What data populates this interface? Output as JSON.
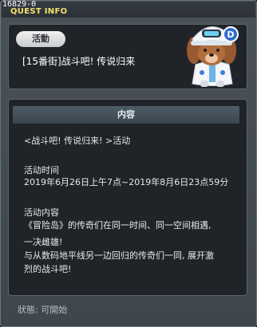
{
  "window": {
    "quest_id": "16829-0",
    "title": "QUEST INFO"
  },
  "header": {
    "category_tag": "活動",
    "quest_name": "[15番街]战斗吧! 传说归来"
  },
  "content": {
    "section_title": "内容",
    "lines": [
      "<战斗吧! 传说归来! >活动",
      "活动时间",
      "2019年6月26日上午7点~2019年8月6日23点59分",
      "活动内容",
      "《冒险岛》的传奇们在同一时间、同一空间相遇,",
      "一决雌雄!",
      "与从数码地平线另一边回归的传奇们一同, 展开激",
      "烈的战斗吧!"
    ]
  },
  "footer": {
    "status": "狀態: 可開始"
  },
  "npc": {
    "icon": "npc-character-icon",
    "badge_letter": "D",
    "colors": {
      "fur": "#b06e3f",
      "helmet": "#f4f6fa",
      "accent": "#3b7fd6",
      "badge": "#2f6fd0"
    }
  }
}
